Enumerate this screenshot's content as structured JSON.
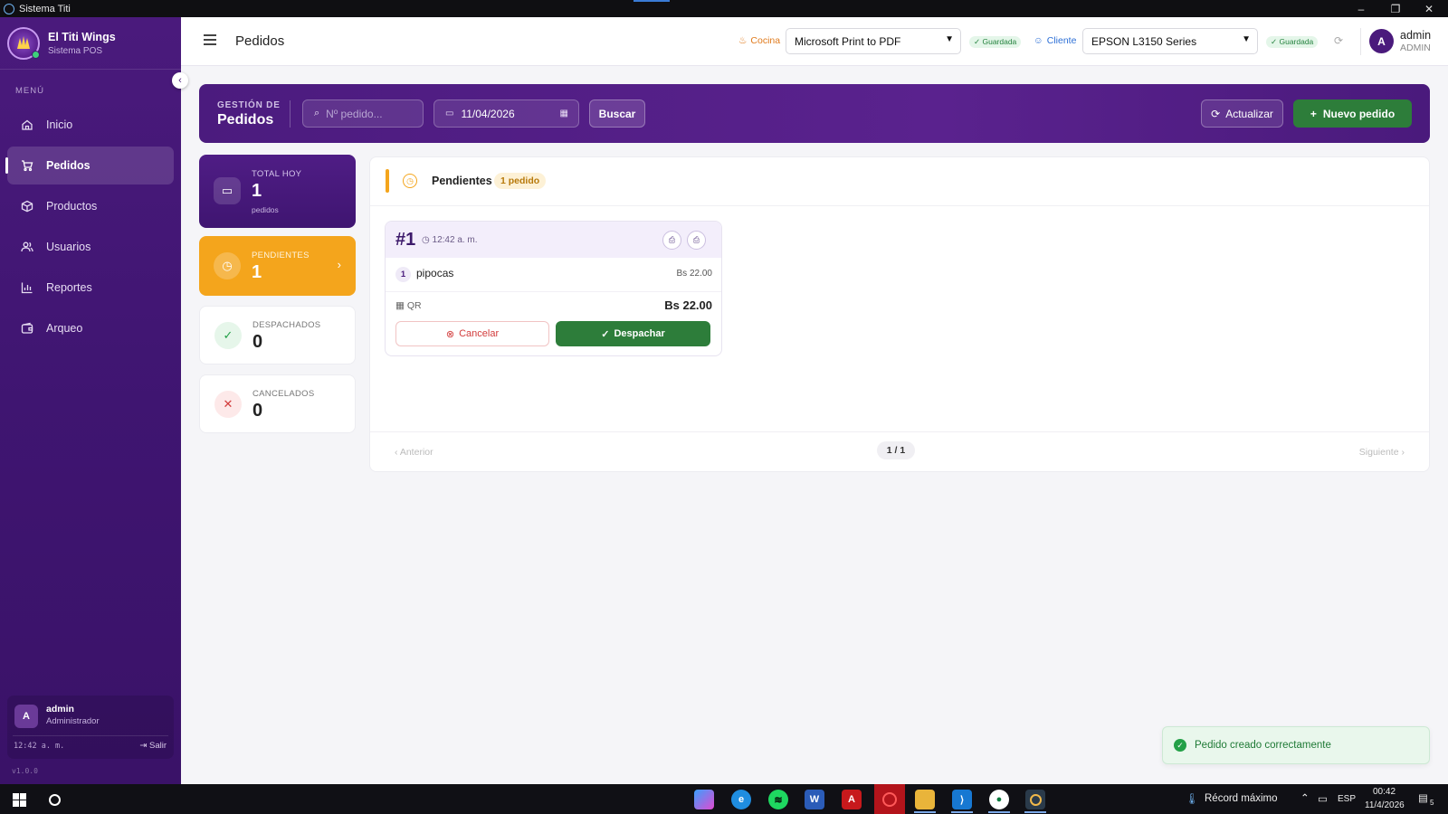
{
  "window": {
    "title": "Sistema Titi",
    "minimize": "–",
    "restore": "❐",
    "close": "✕"
  },
  "brand": {
    "name": "El Titi Wings",
    "subtitle": "Sistema POS"
  },
  "sidebar": {
    "menu_label": "MENÚ",
    "items": [
      {
        "label": "Inicio",
        "icon": "home-icon"
      },
      {
        "label": "Pedidos",
        "icon": "cart-icon",
        "active": true
      },
      {
        "label": "Productos",
        "icon": "box-icon"
      },
      {
        "label": "Usuarios",
        "icon": "users-icon"
      },
      {
        "label": "Reportes",
        "icon": "chart-icon"
      },
      {
        "label": "Arqueo",
        "icon": "wallet-icon"
      }
    ],
    "user": {
      "initial": "A",
      "name": "admin",
      "role": "Administrador",
      "time": "12:42 a. m.",
      "logout": "Salir"
    },
    "version": "v1.0.0"
  },
  "topbar": {
    "title": "Pedidos",
    "kitchen_label": "Cocina",
    "kitchen_printer": "Microsoft Print to PDF",
    "kitchen_status": "✓ Guardada",
    "client_label": "Cliente",
    "client_printer": "EPSON L3150 Series",
    "client_status": "✓ Guardada",
    "user_initial": "A",
    "user_name": "admin",
    "user_role": "ADMIN"
  },
  "hero": {
    "subtitle": "GESTIÓN DE",
    "title": "Pedidos",
    "search_placeholder": "Nº pedido...",
    "date": "11/04/2026",
    "search_button": "Buscar",
    "refresh_button": "Actualizar",
    "new_button": "Nuevo pedido"
  },
  "stats": [
    {
      "label": "TOTAL HOY",
      "value": "1",
      "sub": "pedidos"
    },
    {
      "label": "PENDIENTES",
      "value": "1"
    },
    {
      "label": "DESPACHADOS",
      "value": "0"
    },
    {
      "label": "CANCELADOS",
      "value": "0"
    }
  ],
  "panel": {
    "title": "Pendientes",
    "count_badge": "1 pedido",
    "order": {
      "number": "#1",
      "time": "12:42 a. m.",
      "item_qty": "1",
      "item_name": "pipocas",
      "item_price": "Bs 22.00",
      "payment": "QR",
      "total": "Bs 22.00",
      "cancel_label": "Cancelar",
      "dispatch_label": "Despachar"
    },
    "pager": {
      "prev": "Anterior",
      "page": "1 / 1",
      "next": "Siguiente"
    }
  },
  "toast": {
    "message": "Pedido creado correctamente"
  },
  "taskbar": {
    "weather": "Récord máximo",
    "lang": "ESP",
    "time": "00:42",
    "date": "11/4/2026",
    "notifications": "5"
  },
  "colors": {
    "primary": "#4a1a7c",
    "pending": "#f4a51c",
    "success": "#2d7d3a",
    "danger": "#d23b3b"
  }
}
